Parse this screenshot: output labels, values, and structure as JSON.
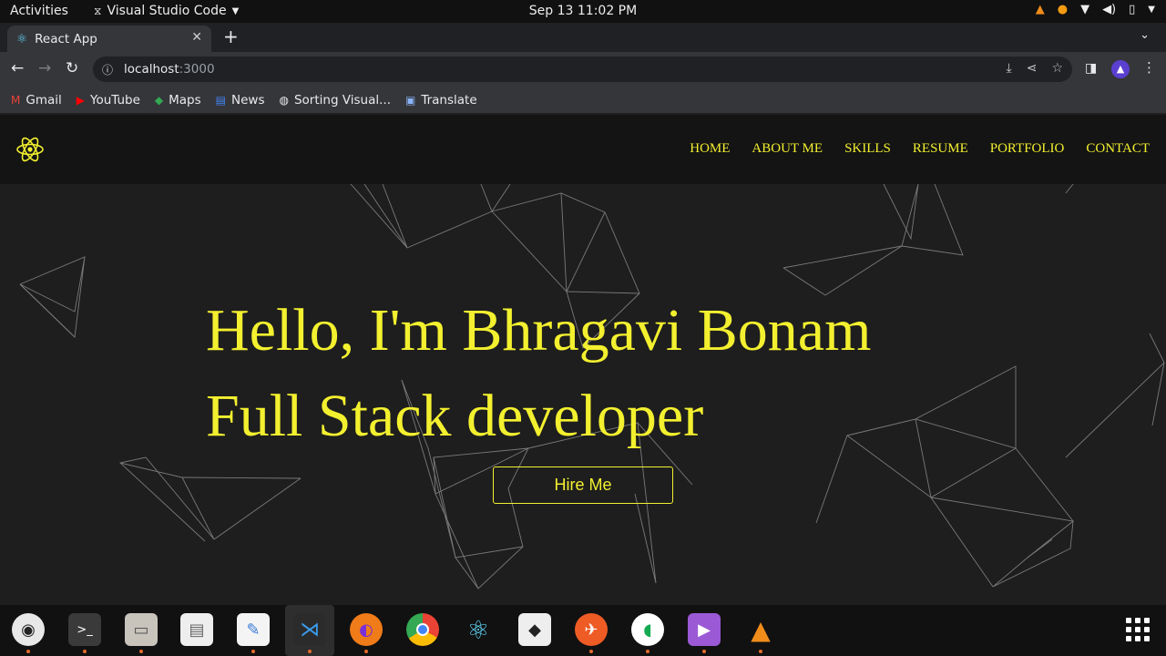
{
  "system": {
    "activities": "Activities",
    "app_name": "Visual Studio Code",
    "clock": "Sep 13  11:02 PM"
  },
  "browser": {
    "tab_title": "React App",
    "url_host": "localhost",
    "url_port": ":3000",
    "bookmarks": [
      {
        "label": "Gmail",
        "icon": "gmail-icon"
      },
      {
        "label": "YouTube",
        "icon": "youtube-icon"
      },
      {
        "label": "Maps",
        "icon": "maps-icon"
      },
      {
        "label": "News",
        "icon": "news-icon"
      },
      {
        "label": "Sorting Visual...",
        "icon": "globe-icon"
      },
      {
        "label": "Translate",
        "icon": "translate-icon"
      }
    ]
  },
  "site": {
    "nav": [
      "HOME",
      "ABOUT ME",
      "SKILLS",
      "RESUME",
      "PORTFOLIO",
      "CONTACT"
    ],
    "hero_line1": "Hello, I'm Bhragavi Bonam",
    "hero_line2": "Full Stack developer",
    "cta": "Hire Me",
    "accent": "#f3f02f"
  },
  "dock": [
    "rhythmbox-icon",
    "terminal-icon",
    "files-icon",
    "document-viewer-icon",
    "text-editor-icon",
    "vscode-icon",
    "firefox-icon",
    "chrome-icon",
    "react-icon",
    "unity-icon",
    "postman-icon",
    "mongodb-compass-icon",
    "video-player-icon",
    "vlc-icon"
  ]
}
